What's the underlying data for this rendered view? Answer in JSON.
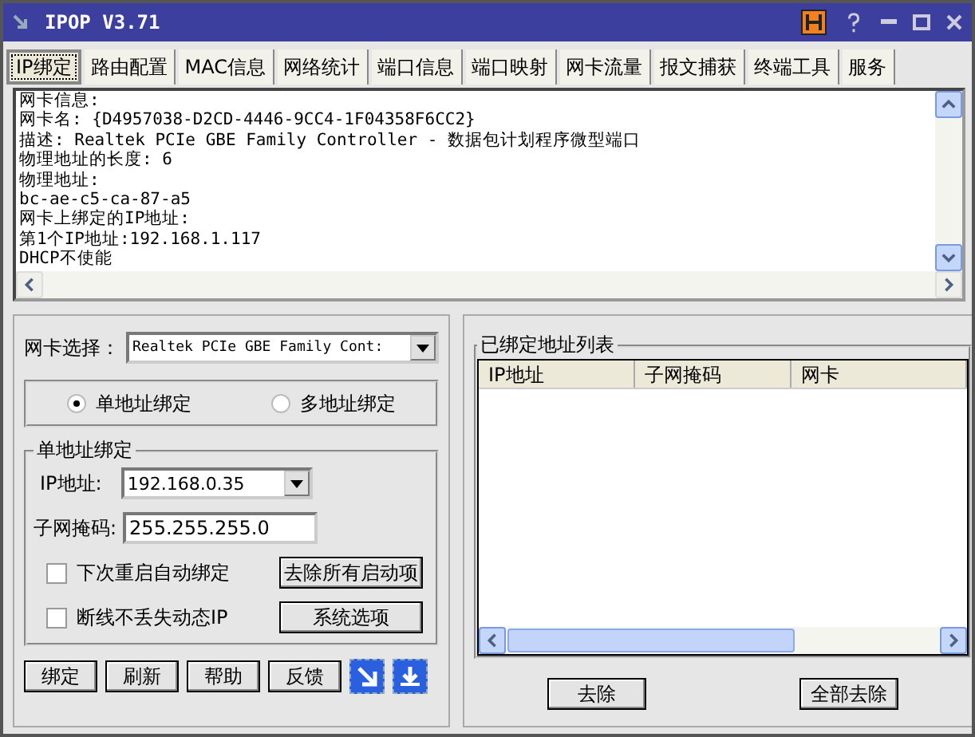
{
  "window": {
    "title": "IPOP V3.71"
  },
  "tabs": [
    {
      "label": "IP绑定",
      "selected": true
    },
    {
      "label": "路由配置",
      "selected": false
    },
    {
      "label": "MAC信息",
      "selected": false
    },
    {
      "label": "网络统计",
      "selected": false
    },
    {
      "label": "端口信息",
      "selected": false
    },
    {
      "label": "端口映射",
      "selected": false
    },
    {
      "label": "网卡流量",
      "selected": false
    },
    {
      "label": "报文捕获",
      "selected": false
    },
    {
      "label": "终端工具",
      "selected": false
    },
    {
      "label": "服务",
      "selected": false
    }
  ],
  "info": {
    "lines": [
      "网卡信息:",
      "网卡名: {D4957038-D2CD-4446-9CC4-1F04358F6CC2}",
      "描述: Realtek PCIe GBE Family Controller - 数据包计划程序微型端口",
      "物理地址的长度: 6",
      "物理地址:",
      "bc-ae-c5-ca-87-a5",
      "网卡上绑定的IP地址:",
      "第1个IP地址:192.168.1.117",
      "DHCP不使能"
    ]
  },
  "binding": {
    "adapter_label": "网卡选择：",
    "adapter_value": "Realtek PCIe GBE Family Cont:",
    "modes": [
      {
        "label": "单地址绑定",
        "selected": true
      },
      {
        "label": "多地址绑定",
        "selected": false
      }
    ],
    "group_title": "单地址绑定",
    "ip_label": "IP地址:",
    "ip_value": "192.168.0.35",
    "mask_label": "子网掩码:",
    "mask_value": "255.255.255.0",
    "options": [
      {
        "label": "下次重启自动绑定",
        "checked": false,
        "button": "去除所有启动项"
      },
      {
        "label": "断线不丢失动态IP",
        "checked": false,
        "button": "系统选项"
      }
    ],
    "buttons": [
      "绑定",
      "刷新",
      "帮助",
      "反馈"
    ]
  },
  "bound_list": {
    "title": "已绑定地址列表",
    "columns": [
      "IP地址",
      "子网掩码",
      "网卡"
    ],
    "buttons": [
      "去除",
      "全部去除"
    ]
  }
}
